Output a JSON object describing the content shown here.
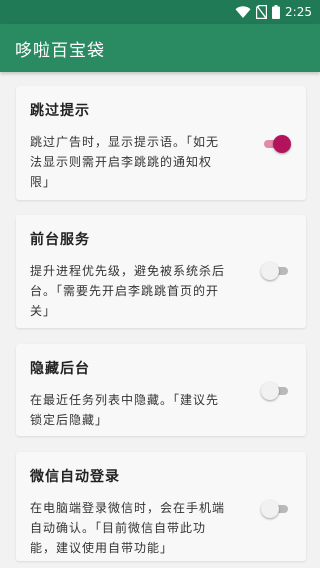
{
  "status_bar": {
    "time": "2:25"
  },
  "app_bar": {
    "title": "哆啦百宝袋"
  },
  "settings": [
    {
      "title": "跳过提示",
      "lines": [
        "跳过广告时，显示提示语。「如无",
        "法显示则需开启李跳跳的通知权",
        "限」"
      ],
      "enabled": true
    },
    {
      "title": "前台服务",
      "lines": [
        "提升进程优先级，避免被系统杀后",
        "台。「需要先开启李跳跳首页的开",
        "关」"
      ],
      "enabled": false
    },
    {
      "title": "隐藏后台",
      "lines": [
        "在最近任务列表中隐藏。「建议先",
        "锁定后隐藏」"
      ],
      "enabled": false
    },
    {
      "title": "微信自动登录",
      "lines": [
        "在电脑端登录微信时，会在手机端",
        "自动确认。「目前微信自带此功",
        "能，建议使用自带功能」"
      ],
      "enabled": false
    }
  ],
  "colors": {
    "status_bar": "#1f7a55",
    "app_bar": "#2a8a62",
    "switch_on_thumb": "#b3135a",
    "switch_on_track": "#e08aa8"
  },
  "icons": [
    "wifi-icon",
    "no-sim-icon",
    "battery-icon"
  ]
}
